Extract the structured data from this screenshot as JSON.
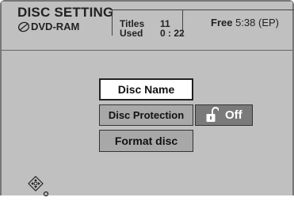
{
  "header": {
    "title": "DISC SETTING",
    "media_type": "DVD-RAM",
    "titles_label": "Titles",
    "titles_value": "11",
    "used_label": "Used",
    "used_value": "0 : 22",
    "free_label": "Free",
    "free_value": "5:38 (EP)"
  },
  "menu": {
    "disc_name": "Disc Name",
    "disc_protection": "Disc Protection",
    "protection_state": "Off",
    "format_disc": "Format disc"
  },
  "icons": {
    "disc": "disc-icon",
    "lock": "unlocked-padlock-icon",
    "navigation": "cursor-navigation-icon"
  },
  "colors": {
    "background": "#c0c0c0",
    "selected_button": "#ffffff",
    "button": "#a8a8a8",
    "state_box": "#7a7a7a"
  }
}
